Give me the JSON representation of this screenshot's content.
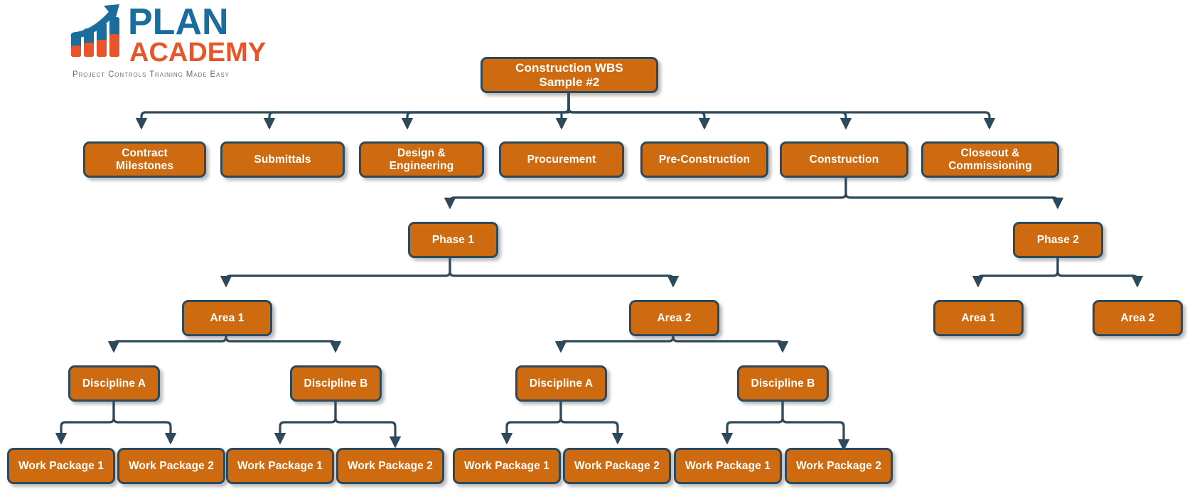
{
  "brand": {
    "name_line1": "PLAN",
    "name_line2": "ACADEMY",
    "tagline": "Project Controls Training Made Easy",
    "blue": "#1a6e9e",
    "orange": "#e8552a",
    "tagline_color": "#6d6e71"
  },
  "theme": {
    "node_fill": "#ce6a10",
    "node_border": "#2d4a5c",
    "node_text": "#ffffff",
    "connector": "#2d4a5c",
    "background": "#ffffff"
  },
  "diagram": {
    "title": "Construction WBS Sample #2",
    "root": {
      "label": "Construction WBS\nSample #2",
      "line1": "Construction WBS",
      "line2": "Sample #2"
    },
    "level1": [
      {
        "id": "contract-milestones",
        "line1": "Contract",
        "line2": "Milestones"
      },
      {
        "id": "submittals",
        "line1": "Submittals",
        "line2": ""
      },
      {
        "id": "design-engineering",
        "line1": "Design &",
        "line2": "Engineering"
      },
      {
        "id": "procurement",
        "line1": "Procurement",
        "line2": ""
      },
      {
        "id": "pre-construction",
        "line1": "Pre-Construction",
        "line2": ""
      },
      {
        "id": "construction",
        "line1": "Construction",
        "line2": ""
      },
      {
        "id": "closeout-commissioning",
        "line1": "Closeout &",
        "line2": "Commissioning"
      }
    ],
    "phases": [
      {
        "id": "phase-1",
        "label": "Phase 1"
      },
      {
        "id": "phase-2",
        "label": "Phase 2"
      }
    ],
    "areas_phase1": [
      {
        "id": "p1-area-1",
        "label": "Area 1"
      },
      {
        "id": "p1-area-2",
        "label": "Area 2"
      }
    ],
    "areas_phase2": [
      {
        "id": "p2-area-1",
        "label": "Area 1"
      },
      {
        "id": "p2-area-2",
        "label": "Area 2"
      }
    ],
    "disciplines": [
      {
        "id": "a1-disc-a",
        "label": "Discipline A"
      },
      {
        "id": "a1-disc-b",
        "label": "Discipline B"
      },
      {
        "id": "a2-disc-a",
        "label": "Discipline A"
      },
      {
        "id": "a2-disc-b",
        "label": "Discipline B"
      }
    ],
    "work_packages": [
      {
        "id": "wp-1",
        "label": "Work Package 1"
      },
      {
        "id": "wp-2",
        "label": "Work Package 2"
      },
      {
        "id": "wp-3",
        "label": "Work Package 1"
      },
      {
        "id": "wp-4",
        "label": "Work Package 2"
      },
      {
        "id": "wp-5",
        "label": "Work Package 1"
      },
      {
        "id": "wp-6",
        "label": "Work Package 2"
      },
      {
        "id": "wp-7",
        "label": "Work Package 1"
      },
      {
        "id": "wp-8",
        "label": "Work Package 2"
      }
    ]
  }
}
